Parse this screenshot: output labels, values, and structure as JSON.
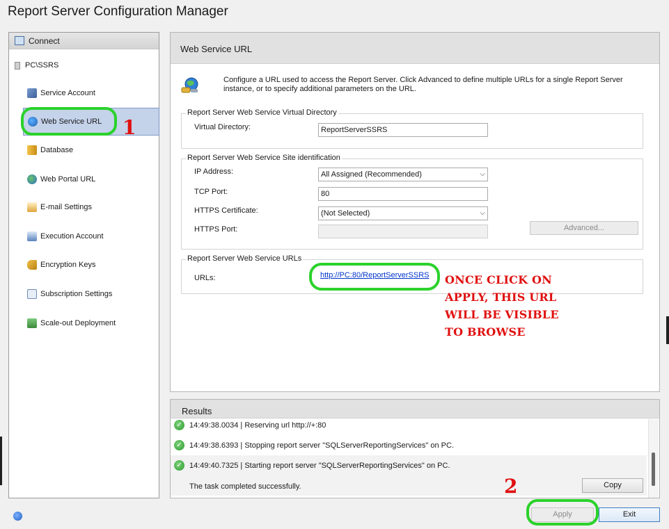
{
  "window": {
    "title": "Report Server Configuration Manager"
  },
  "nav": {
    "connect_label": "Connect",
    "server_name": "PC\\SSRS",
    "items": [
      {
        "label": "Service Account",
        "icon": "service-account-icon"
      },
      {
        "label": "Web Service URL",
        "icon": "web-service-url-icon",
        "selected": true
      },
      {
        "label": "Database",
        "icon": "database-icon"
      },
      {
        "label": "Web Portal URL",
        "icon": "web-portal-url-icon"
      },
      {
        "label": "E-mail Settings",
        "icon": "email-settings-icon"
      },
      {
        "label": "Execution Account",
        "icon": "execution-account-icon"
      },
      {
        "label": "Encryption Keys",
        "icon": "encryption-keys-icon"
      },
      {
        "label": "Subscription Settings",
        "icon": "subscription-settings-icon"
      },
      {
        "label": "Scale-out Deployment",
        "icon": "scale-out-deployment-icon"
      }
    ]
  },
  "main": {
    "title": "Web Service URL",
    "intro": "Configure a URL used to access the Report Server.  Click Advanced to define multiple URLs for a single Report Server instance, or to specify additional parameters on the URL.",
    "virtual_dir": {
      "group_title": "Report Server Web Service Virtual Directory",
      "label": "Virtual Directory:",
      "value": "ReportServerSSRS"
    },
    "site": {
      "group_title": "Report Server Web Service Site identification",
      "ip_label": "IP Address:",
      "ip_value": "All Assigned (Recommended)",
      "tcp_label": "TCP Port:",
      "tcp_value": "80",
      "cert_label": "HTTPS Certificate:",
      "cert_value": "(Not Selected)",
      "https_port_label": "HTTPS Port:",
      "https_port_value": "",
      "advanced_label": "Advanced..."
    },
    "urls": {
      "group_title": "Report Server Web Service URLs",
      "label": "URLs:",
      "link": "http://PC:80/ReportServerSSRS"
    }
  },
  "annotations": {
    "step1": "1",
    "step2": "2",
    "note": "ONCE CLICK ON APPLY, THIS URL WILL BE VISIBLE TO BROWSE",
    "highlight_color": "#2bd22b",
    "text_color": "#e01010"
  },
  "results": {
    "title": "Results",
    "rows": [
      "14:49:38.0034 | Reserving url http://+:80",
      "14:49:38.6393 | Stopping report server \"SQLServerReportingServices\" on PC.",
      "14:49:40.7325 | Starting report server \"SQLServerReportingServices\" on PC."
    ],
    "success_message": "The task completed successfully.",
    "copy_label": "Copy"
  },
  "footer": {
    "apply_label": "Apply",
    "exit_label": "Exit"
  }
}
